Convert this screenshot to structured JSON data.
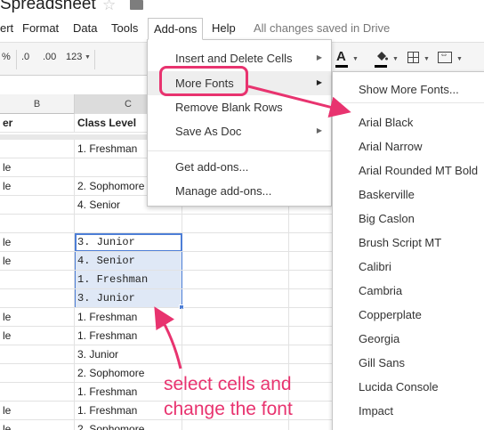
{
  "title": {
    "doc_title": "Spreadsheet"
  },
  "menubar": {
    "items": [
      "ert",
      "Format",
      "Data",
      "Tools",
      "Add-ons",
      "Help"
    ],
    "save_status": "All changes saved in Drive"
  },
  "toolbar": {
    "percent": "%",
    "decrease_decimals": ".0",
    "increase_decimals": ".00",
    "more_formats": "123",
    "font_color_label": "A"
  },
  "grid": {
    "columns": [
      "B",
      "C"
    ],
    "header_row": [
      "er",
      "Class Level"
    ],
    "rows": [
      [
        "",
        "1. Freshman"
      ],
      [
        "le",
        ""
      ],
      [
        "le",
        "2. Sophomore"
      ],
      [
        "",
        "4. Senior"
      ],
      [
        "",
        ""
      ],
      [
        "le",
        "3. Junior"
      ],
      [
        "le",
        "4. Senior"
      ],
      [
        "",
        "1. Freshman"
      ],
      [
        "",
        "3. Junior"
      ],
      [
        "le",
        "1. Freshman"
      ],
      [
        "le",
        "1. Freshman"
      ],
      [
        "",
        "3. Junior"
      ],
      [
        "",
        "2. Sophomore"
      ],
      [
        "",
        "1. Freshman"
      ],
      [
        "le",
        "1. Freshman"
      ],
      [
        "le",
        "2. Sophomore"
      ]
    ]
  },
  "addons_menu": {
    "items": [
      "Insert and Delete Cells",
      "More Fonts",
      "Remove Blank Rows",
      "Save As Doc",
      "Get add-ons...",
      "Manage add-ons..."
    ]
  },
  "fonts_menu": {
    "show_more": "Show More Fonts...",
    "fonts": [
      "Arial Black",
      "Arial Narrow",
      "Arial Rounded MT Bold",
      "Baskerville",
      "Big Caslon",
      "Brush Script MT",
      "Calibri",
      "Cambria",
      "Copperplate",
      "Georgia",
      "Gill Sans",
      "Lucida Console",
      "Impact"
    ]
  },
  "annotation": {
    "line1": "select cells and",
    "line2": "change the font",
    "color": "#e8336f"
  }
}
